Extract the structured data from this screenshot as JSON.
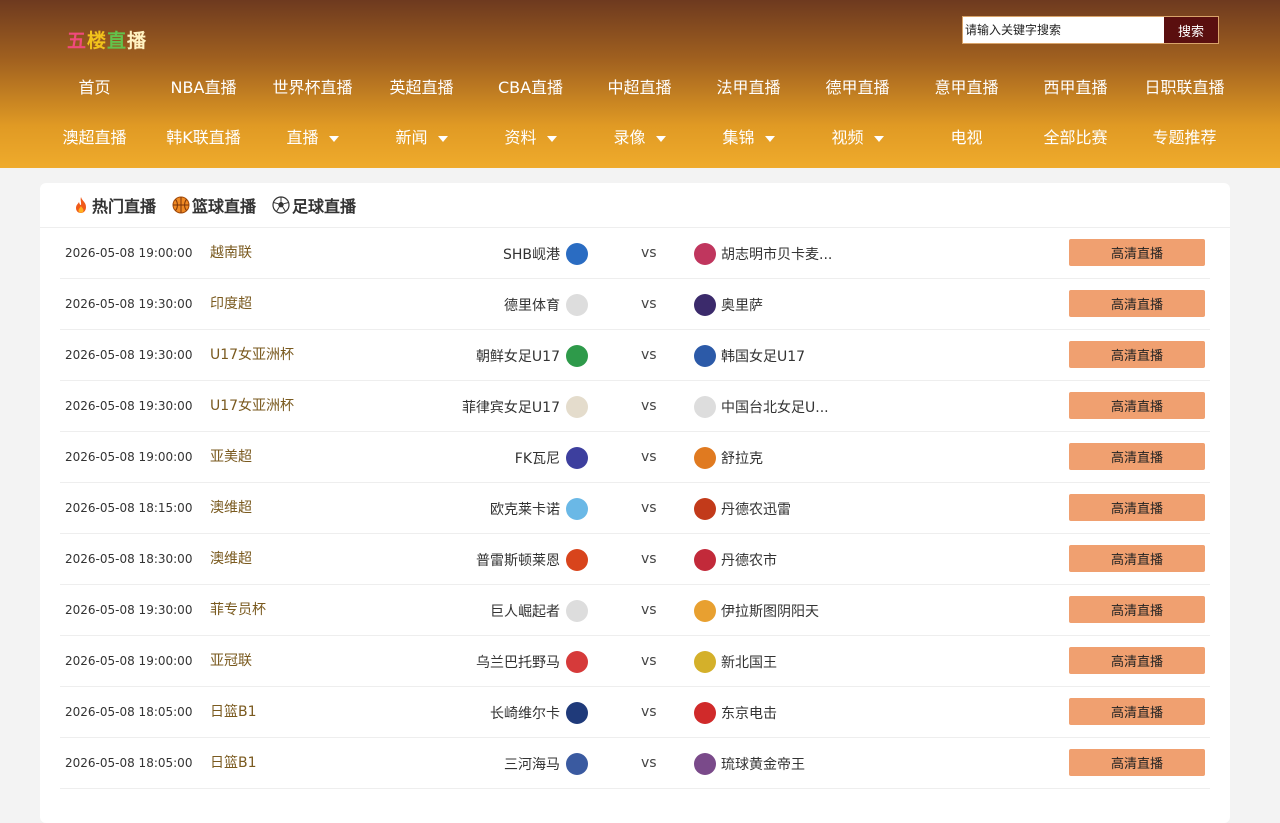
{
  "site": {
    "logo_chars": [
      "五",
      "楼",
      "直",
      "播"
    ]
  },
  "search": {
    "placeholder": "请输入关键字搜索",
    "button": "搜索"
  },
  "nav": {
    "row1": [
      {
        "label": "首页",
        "dropdown": false
      },
      {
        "label": "NBA直播",
        "dropdown": false
      },
      {
        "label": "世界杯直播",
        "dropdown": false
      },
      {
        "label": "英超直播",
        "dropdown": false
      },
      {
        "label": "CBA直播",
        "dropdown": false
      },
      {
        "label": "中超直播",
        "dropdown": false
      },
      {
        "label": "法甲直播",
        "dropdown": false
      },
      {
        "label": "德甲直播",
        "dropdown": false
      },
      {
        "label": "意甲直播",
        "dropdown": false
      },
      {
        "label": "西甲直播",
        "dropdown": false
      },
      {
        "label": "日职联直播",
        "dropdown": false
      }
    ],
    "row2": [
      {
        "label": "澳超直播",
        "dropdown": false
      },
      {
        "label": "韩K联直播",
        "dropdown": false
      },
      {
        "label": "直播",
        "dropdown": true
      },
      {
        "label": "新闻",
        "dropdown": true
      },
      {
        "label": "资料",
        "dropdown": true
      },
      {
        "label": "录像",
        "dropdown": true
      },
      {
        "label": "集锦",
        "dropdown": true
      },
      {
        "label": "视频",
        "dropdown": true
      },
      {
        "label": "电视",
        "dropdown": false
      },
      {
        "label": "全部比赛",
        "dropdown": false
      },
      {
        "label": "专题推荐",
        "dropdown": false
      }
    ]
  },
  "tabs": [
    {
      "label": "热门直播",
      "icon": "fire-icon"
    },
    {
      "label": "篮球直播",
      "icon": "basketball-icon"
    },
    {
      "label": "足球直播",
      "icon": "soccer-ball-icon"
    }
  ],
  "colors": {
    "watch_button": "#f0a070",
    "search_button": "#5a0f0f",
    "league_text": "#7a5a1f"
  },
  "vs_label": "vs",
  "matches": [
    {
      "time": "2026-05-08 19:00:00",
      "league": "越南联",
      "home": "SHB岘港",
      "away": "胡志明市贝卡麦...",
      "button": "高清直播",
      "home_badge": "#2a6cc2",
      "away_badge": "#c0365e"
    },
    {
      "time": "2026-05-08 19:30:00",
      "league": "印度超",
      "home": "德里体育",
      "away": "奥里萨",
      "button": "高清直播",
      "home_badge": "#dddddd",
      "away_badge": "#3b2a6b"
    },
    {
      "time": "2026-05-08 19:30:00",
      "league": "U17女亚洲杯",
      "home": "朝鲜女足U17",
      "away": "韩国女足U17",
      "button": "高清直播",
      "home_badge": "#2e9a4a",
      "away_badge": "#2c5aa8"
    },
    {
      "time": "2026-05-08 19:30:00",
      "league": "U17女亚洲杯",
      "home": "菲律宾女足U17",
      "away": "中国台北女足U...",
      "button": "高清直播",
      "home_badge": "#e4dccc",
      "away_badge": "#dddddd"
    },
    {
      "time": "2026-05-08 19:00:00",
      "league": "亚美超",
      "home": "FK瓦尼",
      "away": "舒拉克",
      "button": "高清直播",
      "home_badge": "#3d3f9e",
      "away_badge": "#e07a20"
    },
    {
      "time": "2026-05-08 18:15:00",
      "league": "澳维超",
      "home": "欧克莱卡诺",
      "away": "丹德农迅雷",
      "button": "高清直播",
      "home_badge": "#6ab8e6",
      "away_badge": "#c23a1a"
    },
    {
      "time": "2026-05-08 18:30:00",
      "league": "澳维超",
      "home": "普雷斯顿莱恩",
      "away": "丹德农市",
      "button": "高清直播",
      "home_badge": "#d8441c",
      "away_badge": "#c22a3a"
    },
    {
      "time": "2026-05-08 19:30:00",
      "league": "菲专员杯",
      "home": "巨人崛起者",
      "away": "伊拉斯图阴阳天",
      "button": "高清直播",
      "home_badge": "#dddddd",
      "away_badge": "#e8a030"
    },
    {
      "time": "2026-05-08 19:00:00",
      "league": "亚冠联",
      "home": "乌兰巴托野马",
      "away": "新北国王",
      "button": "高清直播",
      "home_badge": "#d63a3a",
      "away_badge": "#d4b02a"
    },
    {
      "time": "2026-05-08 18:05:00",
      "league": "日篮B1",
      "home": "长崎维尔卡",
      "away": "东京电击",
      "button": "高清直播",
      "home_badge": "#1f3a7a",
      "away_badge": "#d02a2a"
    },
    {
      "time": "2026-05-08 18:05:00",
      "league": "日篮B1",
      "home": "三河海马",
      "away": "琉球黄金帝王",
      "button": "高清直播",
      "home_badge": "#3a5aa0",
      "away_badge": "#7a4a8a"
    }
  ]
}
